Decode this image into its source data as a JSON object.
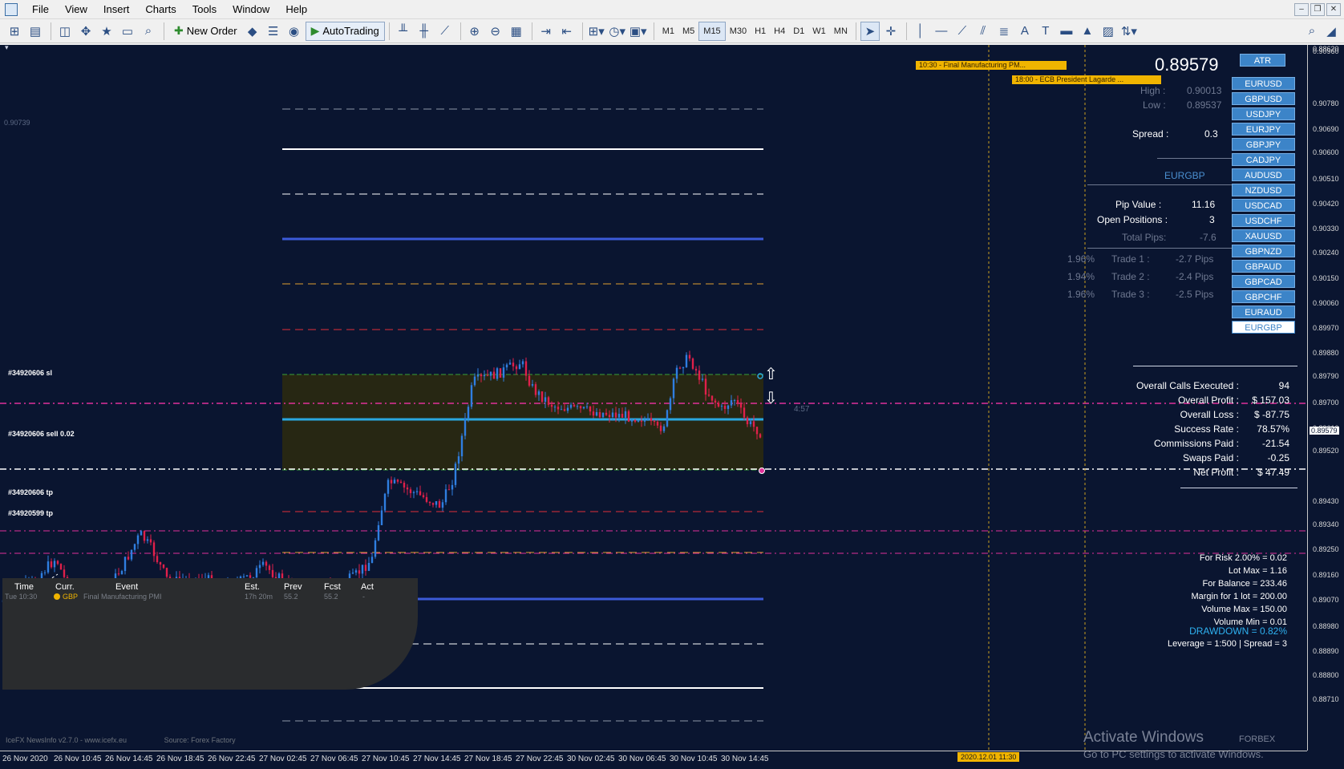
{
  "menu": [
    "File",
    "View",
    "Insert",
    "Charts",
    "Tools",
    "Window",
    "Help"
  ],
  "toolbar": {
    "new_order": "New Order",
    "autotrading": "AutoTrading",
    "timeframes": [
      "M1",
      "M5",
      "M15",
      "M30",
      "H1",
      "H4",
      "D1",
      "W1",
      "MN"
    ],
    "active_timeframe": "M15"
  },
  "header": {
    "current_price": "0.89579",
    "high_label": "High :",
    "high": "0.90013",
    "low_label": "Low :",
    "low": "0.89537",
    "spread_label": "Spread :",
    "spread": "0.3",
    "symbol": "EURGBP",
    "pip_value_label": "Pip Value :",
    "pip_value": "11.16",
    "open_positions_label": "Open Positions :",
    "open_positions": "3",
    "total_pips_label": "Total Pips:",
    "total_pips": "-7.6"
  },
  "trades": [
    {
      "pct": "1.96%",
      "label": "Trade 1 :",
      "pips": "-2.7 Pips"
    },
    {
      "pct": "1.94%",
      "label": "Trade 2 :",
      "pips": "-2.4 Pips"
    },
    {
      "pct": "1.96%",
      "label": "Trade 3 :",
      "pips": "-2.5 Pips"
    }
  ],
  "symbols": {
    "atr": "ATR",
    "list": [
      "EURUSD",
      "GBPUSD",
      "USDJPY",
      "EURJPY",
      "GBPJPY",
      "CADJPY",
      "AUDUSD",
      "NZDUSD",
      "USDCAD",
      "USDCHF",
      "XAUUSD",
      "GBPNZD",
      "GBPAUD",
      "GBPCAD",
      "GBPCHF",
      "EURAUD",
      "EURGBP"
    ],
    "active": "EURGBP"
  },
  "stats": [
    {
      "label": "Overall Calls Executed :",
      "value": "94"
    },
    {
      "label": "Overall Profit :",
      "value": "$ 157.03"
    },
    {
      "label": "Overall Loss :",
      "value": "$ -87.75"
    },
    {
      "label": "Success Rate :",
      "value": "78.57%"
    },
    {
      "label": "Commissions Paid :",
      "value": "-21.54"
    },
    {
      "label": "Swaps Paid :",
      "value": "-0.25"
    },
    {
      "label": "Net Profit :",
      "value": "$ 47.49"
    }
  ],
  "risk": [
    "For Risk 2.00% = 0.02",
    "Lot Max = 1.16",
    "For Balance = 233.46",
    "Margin for 1 lot = 200.00",
    "Volume Max = 150.00",
    "Volume Min = 0.01"
  ],
  "drawdown": "DRAWDOWN =  0.82%",
  "leverage": "Leverage = 1:500 | Spread = 3",
  "trade_labels": {
    "sl": "#34920606 sl",
    "sell": "#34920606 sell 0.02",
    "tp1": "#34920606 tp",
    "tp2": "#34920599 tp",
    "countdown": "4:57",
    "corner_price": "0.90739"
  },
  "news_flags": [
    "10:30 - Final Manufacturing PM...",
    "18:00 - ECB President Lagarde ..."
  ],
  "news_panel": {
    "headers": [
      "Time",
      "Curr.",
      "Event",
      "Est.",
      "Prev",
      "Fcst",
      "Act"
    ],
    "row": {
      "time": "Tue  10:30",
      "curr": "GBP",
      "event": "Final Manufacturing PMI",
      "est": "17h 20m",
      "prev": "55.2",
      "fcst": "55.2",
      "act": "-"
    },
    "footer_left": "IceFX NewsInfo v2.7.0  -  www.icefx.eu",
    "footer_right": "Source: Forex Factory"
  },
  "price_axis": [
    "0.90960",
    "0.90780",
    "0.90690",
    "0.90600",
    "0.90510",
    "0.90420",
    "0.90330",
    "0.90240",
    "0.90150",
    "0.90060",
    "0.89970",
    "0.89880",
    "0.89790",
    "0.89700",
    "0.89610",
    "0.89520",
    "0.89430",
    "0.89340",
    "0.89250",
    "0.89160",
    "0.89070",
    "0.88980",
    "0.88890",
    "0.88800",
    "0.88710",
    "0.88620"
  ],
  "price_axis_current": "0.89579",
  "time_axis": [
    "26 Nov 2020",
    "26 Nov 10:45",
    "26 Nov 14:45",
    "26 Nov 18:45",
    "26 Nov 22:45",
    "27 Nov 02:45",
    "27 Nov 06:45",
    "27 Nov 10:45",
    "27 Nov 14:45",
    "27 Nov 18:45",
    "27 Nov 22:45",
    "30 Nov 02:45",
    "30 Nov 06:45",
    "30 Nov 10:45",
    "30 Nov 14:45"
  ],
  "date_flag": "2020.12.01 11:30",
  "watermark": {
    "line1": "Activate Windows",
    "line2": "Go to PC settings to activate Windows."
  },
  "broker": "FORBEX",
  "colors": {
    "background": "#0a1530",
    "bull": "#2f7ee0",
    "bear": "#e0204a",
    "zone": "#2a2a0e",
    "symbol_button": "#3c84c8",
    "news": "#f0b400"
  }
}
